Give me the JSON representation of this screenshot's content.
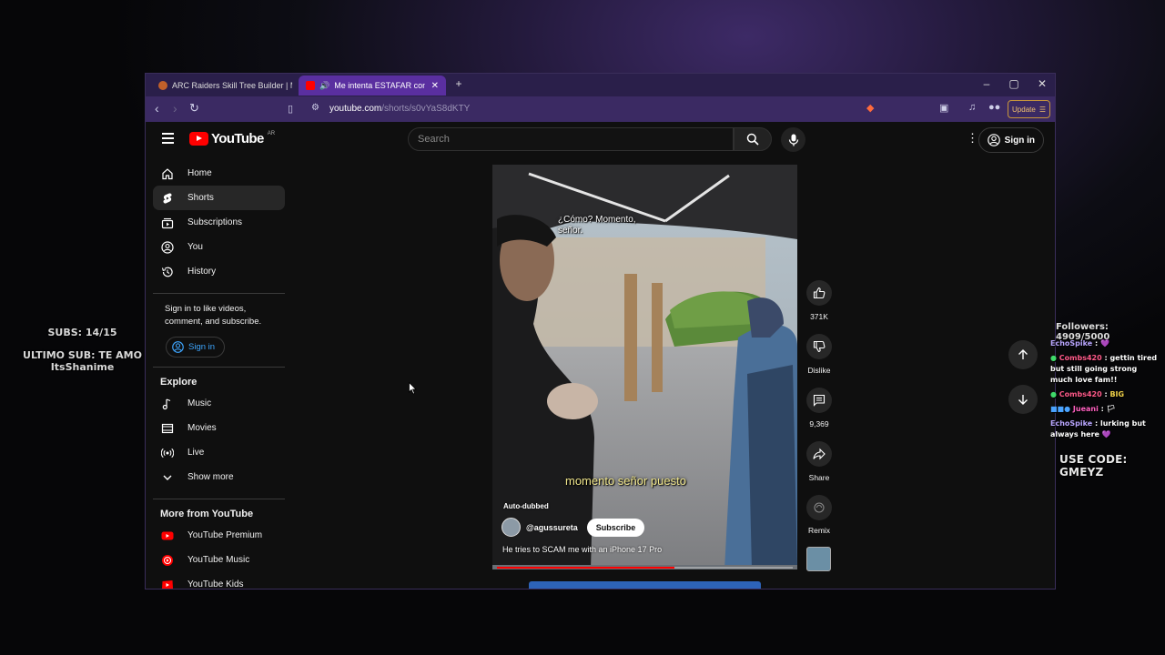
{
  "stream_overlay": {
    "subs_count": "SUBS: 14/15",
    "last_sub": "ULTIMO SUB: TE AMO ItsShanime",
    "followers": "Followers: 4909/5000",
    "use_code": "USE CODE: GMEYZ",
    "chat": [
      {
        "user": "EchoSpike",
        "message": "💜"
      },
      {
        "user": "Combs420",
        "message": "gettin tired but still going strong much love fam!!"
      },
      {
        "user": "Combs420",
        "message": "BIG"
      },
      {
        "user": "Jueani",
        "message": "🏳"
      },
      {
        "user": "EchoSpike",
        "message": "lurking but always here 💜"
      }
    ]
  },
  "browser": {
    "tabs": [
      {
        "label": "ARC Raiders Skill Tree Builder | Metaf",
        "active": false
      },
      {
        "label": "Me intenta ESTAFAR con un iP",
        "active": true
      }
    ],
    "url_host": "youtube.com",
    "url_path": "/shorts/s0vYaS8dKTY",
    "update_label": "Update"
  },
  "youtube": {
    "logo_text": "YouTube",
    "region": "AR",
    "search_placeholder": "Search",
    "signin_label": "Sign in",
    "sidebar": {
      "primary": [
        {
          "label": "Home",
          "icon": "home-icon"
        },
        {
          "label": "Shorts",
          "icon": "shorts-icon",
          "active": true
        },
        {
          "label": "Subscriptions",
          "icon": "subscriptions-icon"
        },
        {
          "label": "You",
          "icon": "you-icon"
        },
        {
          "label": "History",
          "icon": "history-icon"
        }
      ],
      "signin_prompt": "Sign in to like videos, comment, and subscribe.",
      "signin_button": "Sign in",
      "explore_title": "Explore",
      "explore": [
        {
          "label": "Music",
          "icon": "music-icon"
        },
        {
          "label": "Movies",
          "icon": "movies-icon"
        },
        {
          "label": "Live",
          "icon": "live-icon"
        },
        {
          "label": "Show more",
          "icon": "chevron-down-icon"
        }
      ],
      "more_title": "More from YouTube",
      "more": [
        {
          "label": "YouTube Premium"
        },
        {
          "label": "YouTube Music"
        },
        {
          "label": "YouTube Kids"
        }
      ]
    },
    "short": {
      "caption_top": "¿Cómo? Momento, señor.",
      "caption_bottom": "momento señor puesto",
      "auto_dubbed": "Auto-dubbed",
      "channel": "@agussureta",
      "subscribe_label": "Subscribe",
      "title": "He tries to SCAM me with an iPhone 17 Pro",
      "progress": 0.6
    },
    "actions": {
      "likes": "371K",
      "dislike": "Dislike",
      "comments": "9,369",
      "share": "Share",
      "remix": "Remix"
    },
    "colors": {
      "brand_red": "#ff0000",
      "link_blue": "#3ea6ff",
      "tab_purple": "#5a2fa0"
    }
  }
}
